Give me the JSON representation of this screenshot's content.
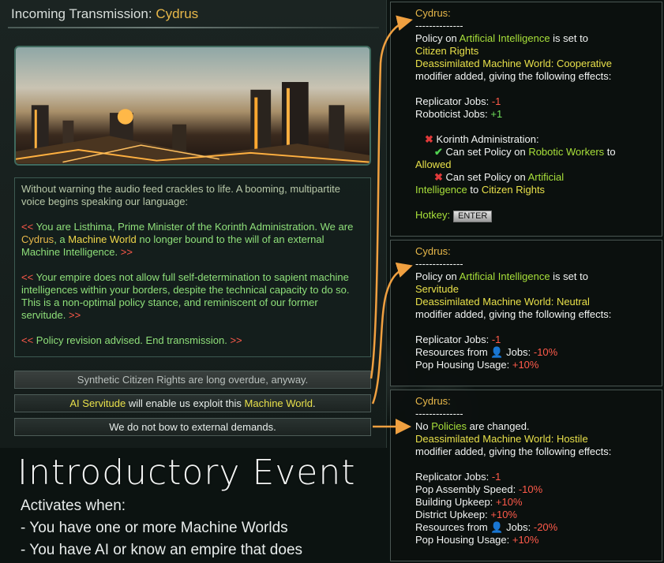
{
  "event": {
    "title_prefix": "Incoming Transmission:",
    "title_name": "Cydrus",
    "paragraphs": {
      "p1": "Without warning the audio feed crackles to life. A booming, multipartite voice begins speaking our language:",
      "p2_open": "<<",
      "p2_a": " You are Listhima, Prime Minister of the Korinth Administration. We are ",
      "p2_cydrus": "Cydrus",
      "p2_b": ", a ",
      "p2_mw": "Machine World",
      "p2_c": " no longer bound to the will of an external Machine Intelligence. ",
      "p2_close": ">>",
      "p3_open": "<<",
      "p3_text": " Your empire does not allow full self-determination to sapient machine intelligences within your borders, despite the technical capacity to do so. This is a non-optimal policy stance, and reminiscent of our former servitude. ",
      "p3_close": ">>",
      "p4_open": "<<",
      "p4_text": " Policy revision advised. End transmission. ",
      "p4_close": ">>"
    },
    "options": {
      "opt1": "Synthetic Citizen Rights are long overdue, anyway.",
      "opt2_a": "AI Servitude",
      "opt2_b": " will enable us exploit this ",
      "opt2_c": "Machine World",
      "opt2_d": ".",
      "opt3": "We do not bow to external demands."
    }
  },
  "caption": {
    "title": "Introductory Event",
    "line1": "Activates when:",
    "line2": "- You have one or more Machine Worlds",
    "line3": "- You have AI or know an empire that does"
  },
  "tooltips": {
    "t1": {
      "name": "Cydrus:",
      "dashes": "--------------",
      "l1a": "Policy on ",
      "l1b": "Artificial Intelligence",
      "l1c": " is set to",
      "l2": "Citizen Rights",
      "l3": "Deassimilated Machine World: Cooperative",
      "l4": "modifier added, giving the following effects:",
      "e1a": "Replicator Jobs: ",
      "e1b": "-1",
      "e2a": "Roboticist Jobs: ",
      "e2b": "+1",
      "c1": "Korinth Administration:",
      "c2a": "Can set Policy on ",
      "c2b": "Robotic Workers",
      "c2c": " to",
      "c2d": "Allowed",
      "c3a": "Can set Policy on ",
      "c3b": "Artificial",
      "c3c": "Intelligence",
      "c3d": " to ",
      "c3e": "Citizen Rights",
      "hotkey": "Hotkey:",
      "key": "ENTER"
    },
    "t2": {
      "name": "Cydrus:",
      "dashes": "--------------",
      "l1a": "Policy on ",
      "l1b": "Artificial Intelligence",
      "l1c": " is set to",
      "l2": "Servitude",
      "l3": "Deassimilated Machine World: Neutral",
      "l4": "modifier added, giving the following effects:",
      "e1a": "Replicator Jobs: ",
      "e1b": "-1",
      "e2a": "Resources from ",
      "e2b": " Jobs: ",
      "e2c": "-10%",
      "e3a": "Pop Housing Usage: ",
      "e3b": "+10%"
    },
    "t3": {
      "name": "Cydrus:",
      "dashes": "--------------",
      "l1a": "No ",
      "l1b": "Policies",
      "l1c": " are changed.",
      "l2": "Deassimilated Machine World: Hostile",
      "l3": "modifier added, giving the following effects:",
      "e1a": "Replicator Jobs: ",
      "e1b": "-1",
      "e2a": "Pop Assembly Speed: ",
      "e2b": "-10%",
      "e3a": "Building Upkeep: ",
      "e3b": "+10%",
      "e4a": "District Upkeep: ",
      "e4b": "+10%",
      "e5a": "Resources from ",
      "e5b": " Jobs: ",
      "e5c": "-20%",
      "e6a": "Pop Housing Usage: ",
      "e6b": "+10%"
    }
  },
  "colors": {
    "accent_orange": "#e8b84a",
    "text_green": "#8fe07a",
    "text_yellow": "#f0d84a",
    "text_red": "#ff5a4a",
    "arrow": "#f0a040"
  }
}
